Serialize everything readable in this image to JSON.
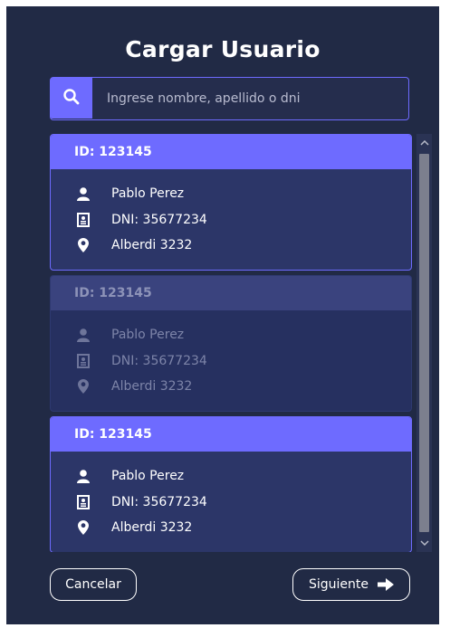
{
  "dialog": {
    "title": "Cargar Usuario"
  },
  "search": {
    "placeholder": "Ingrese nombre, apellido o dni",
    "icon": "search-icon"
  },
  "cards": [
    {
      "id_label": "ID: 123145",
      "name": "Pablo Perez",
      "dni": "DNI: 35677234",
      "address": "Alberdi 3232",
      "state": "active"
    },
    {
      "id_label": "ID: 123145",
      "name": "Pablo Perez",
      "dni": "DNI: 35677234",
      "address": "Alberdi 3232",
      "state": "dimmed"
    },
    {
      "id_label": "ID: 123145",
      "name": "Pablo Perez",
      "dni": "DNI: 35677234",
      "address": "Alberdi 3232",
      "state": "active"
    }
  ],
  "footer": {
    "cancel_label": "Cancelar",
    "next_label": "Siguiente"
  },
  "colors": {
    "background": "#212a45",
    "accent": "#6e6bff",
    "card": "#2c3668"
  }
}
